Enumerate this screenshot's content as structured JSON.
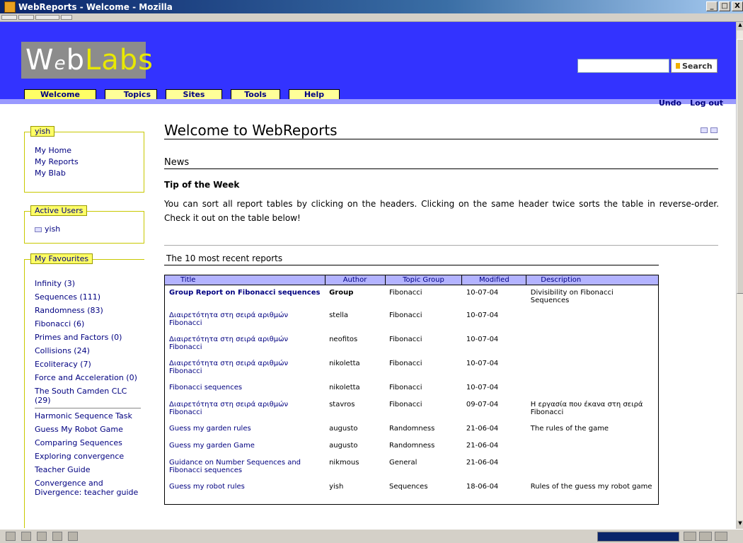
{
  "window": {
    "title": "WebReports - Welcome - Mozilla",
    "minimize": "_",
    "maximize": "□",
    "close": "X"
  },
  "header": {
    "logo_w": "W",
    "logo_e": "e",
    "logo_b": "b",
    "logo_labs": "Labs",
    "search_placeholder": "",
    "search_button": "Search",
    "tabs": [
      "Welcome",
      "Topics",
      "Sites",
      "Tools",
      "Help"
    ],
    "links": [
      "Undo",
      "Log out"
    ],
    "colors": {
      "header_bg": "#3333ff",
      "tab_bg": "#ffff66",
      "subbar": "#9999ff"
    }
  },
  "sidebar": {
    "user_box": {
      "title": "yish",
      "items": [
        "My Home",
        "My Reports",
        "My Blab"
      ]
    },
    "active_users": {
      "title": "Active Users",
      "users": [
        "yish"
      ]
    },
    "favourites": {
      "title": "My Favourites",
      "items": [
        "Infinity (3)",
        "Sequences (111)",
        "Randomness (83)",
        "Fibonacci (6)",
        "Primes and Factors (0)",
        "Collisions (24)",
        "Ecoliteracy (7)",
        "Force and Acceleration (0)",
        "The South Camden CLC (29)",
        "Harmonic Sequence Task",
        "Guess My Robot Game",
        "Comparing Sequences",
        "Exploring convergence",
        "Teacher Guide",
        "Convergence and Divergence: teacher guide"
      ]
    }
  },
  "main": {
    "title": "Welcome to WebReports",
    "news_heading": "News",
    "tip_heading": "Tip of the Week",
    "tip_text": "You can sort all report tables by clicking on the headers. Clicking on the same header twice sorts the table in reverse-order. Check it out on the table below!",
    "recent_heading": "The 10 most recent reports",
    "table": {
      "headers": [
        "Title",
        "Author",
        "Topic Group",
        "Modified",
        "Description"
      ],
      "rows": [
        [
          "Group Report on Fibonacci sequences",
          "Group",
          "Fibonacci",
          "10-07-04",
          "Divisibility on Fibonacci Sequences"
        ],
        [
          "Διαιρετότητα στη σειρά αριθμών Fibonacci",
          "stella",
          "Fibonacci",
          "10-07-04",
          ""
        ],
        [
          "Διαιρετότητα στη σειρά αριθμών Fibonacci",
          "neofitos",
          "Fibonacci",
          "10-07-04",
          ""
        ],
        [
          "Διαιρετότητα στη σειρά αριθμών Fibonacci",
          "nikoletta",
          "Fibonacci",
          "10-07-04",
          ""
        ],
        [
          "Fibonacci sequences",
          "nikoletta",
          "Fibonacci",
          "10-07-04",
          ""
        ],
        [
          "Διαιρετότητα στη σειρά αριθμών Fibonacci",
          "stavros",
          "Fibonacci",
          "09-07-04",
          "Η εργασία που έκανα στη σειρά Fibonacci"
        ],
        [
          "Guess my garden rules",
          "augusto",
          "Randomness",
          "21-06-04",
          "The rules of the game"
        ],
        [
          "Guess my garden Game",
          "augusto",
          "Randomness",
          "21-06-04",
          ""
        ],
        [
          "Guidance on Number Sequences and Fibonacci sequences",
          "nikmous",
          "General",
          "21-06-04",
          ""
        ],
        [
          "Guess my robot rules",
          "yish",
          "Sequences",
          "18-06-04",
          "Rules of the guess my robot game"
        ]
      ]
    }
  }
}
